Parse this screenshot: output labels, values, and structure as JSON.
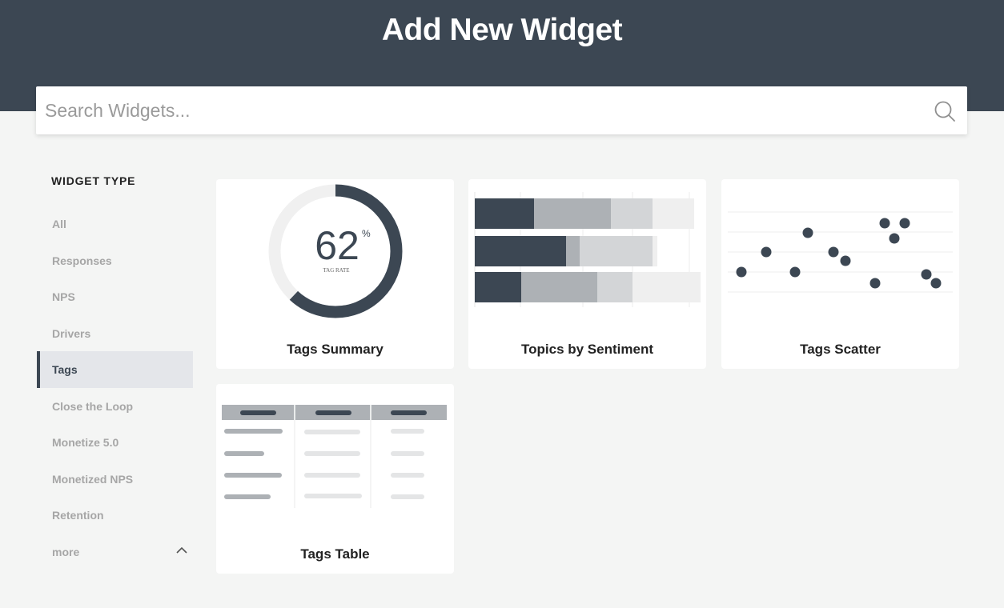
{
  "header": {
    "title": "Add New Widget"
  },
  "search": {
    "placeholder": "Search Widgets..."
  },
  "sidebar": {
    "heading": "WIDGET TYPE",
    "items": [
      {
        "label": "All"
      },
      {
        "label": "Responses"
      },
      {
        "label": "NPS"
      },
      {
        "label": "Drivers"
      },
      {
        "label": "Tags",
        "active": true
      },
      {
        "label": "Close the Loop"
      },
      {
        "label": "Monetize 5.0"
      },
      {
        "label": "Monetized NPS"
      },
      {
        "label": "Retention"
      },
      {
        "label": "more",
        "icon": "chevron-up-icon"
      }
    ]
  },
  "widgets": [
    {
      "title": "Tags Summary",
      "preview": {
        "value": "62",
        "unit": "%",
        "caption": "TAG RATE",
        "percent": 62
      }
    },
    {
      "title": "Topics by Sentiment"
    },
    {
      "title": "Tags Scatter"
    },
    {
      "title": "Tags Table"
    }
  ],
  "colors": {
    "header_bg": "#3c4753",
    "accent_dark": "#3c4753",
    "mid_gray": "#adb1b5",
    "light_gray": "#d3d5d7",
    "lightest_gray": "#efefef",
    "page_bg": "#f4f5f4"
  }
}
